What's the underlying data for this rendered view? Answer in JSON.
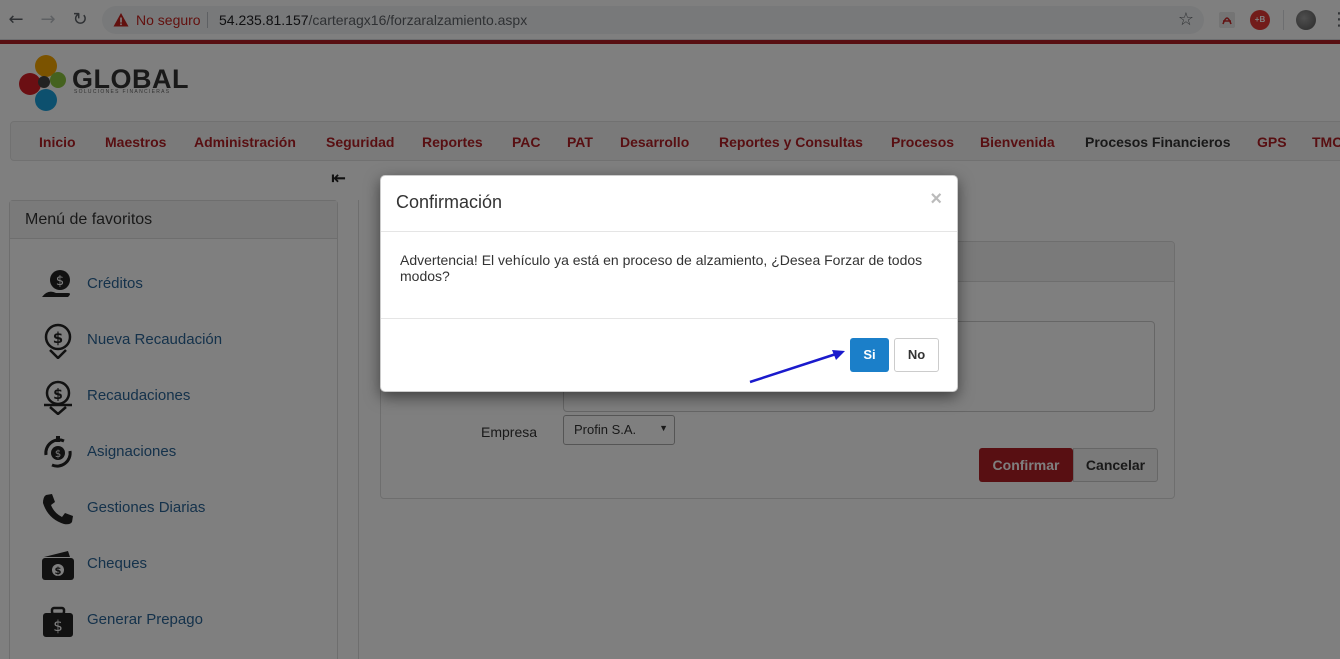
{
  "browser": {
    "security_label": "No seguro",
    "url_host": "54.235.81.157",
    "url_path": "/carteragx16/forzaralzamiento.aspx"
  },
  "logo": {
    "name": "GLOBAL",
    "tagline": "SOLUCIONES FINANCIERAS"
  },
  "nav": {
    "items": [
      "Inicio",
      "Maestros",
      "Administración",
      "Seguridad",
      "Reportes",
      "PAC",
      "PAT",
      "Desarrollo",
      "Reportes y Consultas",
      "Procesos",
      "Bienvenida",
      "Procesos Financieros",
      "GPS",
      "TMC"
    ]
  },
  "favorites": {
    "title": "Menú de favoritos",
    "items": [
      {
        "label": "Créditos",
        "icon": "money-hand-icon"
      },
      {
        "label": "Nueva Recaudación",
        "icon": "money-down-icon"
      },
      {
        "label": "Recaudaciones",
        "icon": "money-stack-icon"
      },
      {
        "label": "Asignaciones",
        "icon": "money-cycle-icon"
      },
      {
        "label": "Gestiones Diarias",
        "icon": "phone-icon"
      },
      {
        "label": "Cheques",
        "icon": "wallet-icon"
      },
      {
        "label": "Generar Prepago",
        "icon": "briefcase-icon"
      }
    ]
  },
  "form": {
    "empresa_label": "Empresa",
    "empresa_value": "Profin S.A.",
    "confirm_label": "Confirmar",
    "cancel_label": "Cancelar"
  },
  "modal": {
    "title": "Confirmación",
    "close_glyph": "×",
    "message": "Advertencia! El vehículo ya está en proceso de alzamiento, ¿Desea Forzar de todos modos?",
    "yes_label": "Si",
    "no_label": "No"
  },
  "colors": {
    "brand_red": "#b11f24",
    "link_blue": "#2a6496",
    "primary_blue": "#1b7fc9",
    "annotation_arrow": "#1a1acc"
  }
}
